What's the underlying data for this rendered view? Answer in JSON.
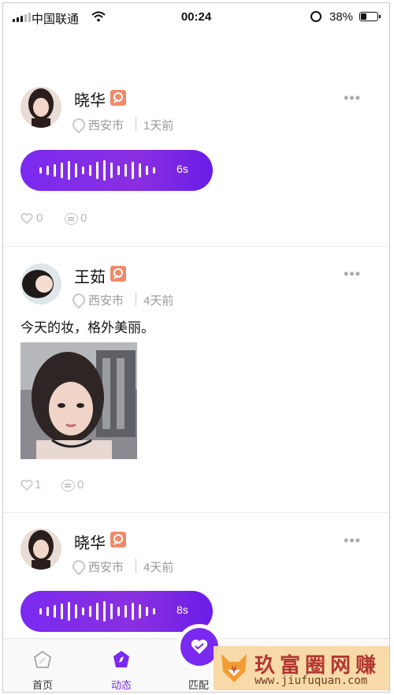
{
  "status_bar": {
    "carrier": "中国联通",
    "time": "00:24",
    "battery": "38%",
    "battery_level": 0.38,
    "signal_bars": 3
  },
  "feed": [
    {
      "user": "晓华",
      "location": "西安市",
      "time": "1天前",
      "voice_duration": "6s",
      "likes": "0",
      "comments": "0"
    },
    {
      "user": "王茹",
      "location": "西安市",
      "time": "4天前",
      "text": "今天的妆，格外美丽。",
      "likes": "1",
      "comments": "0"
    },
    {
      "user": "晓华",
      "location": "西安市",
      "time": "4天前",
      "voice_duration": "8s"
    }
  ],
  "tabs": [
    {
      "label": "首页",
      "icon": "home-icon"
    },
    {
      "label": "动态",
      "icon": "compass-icon",
      "active": true
    },
    {
      "label": "匹配",
      "icon": "heart-match-icon"
    }
  ],
  "watermark": {
    "brand": "玖富圈网赚",
    "url": "www.jiufuquan.com"
  },
  "colors": {
    "accent": "#7a2af0",
    "badge": "#f08a6a",
    "muted": "#999999"
  }
}
